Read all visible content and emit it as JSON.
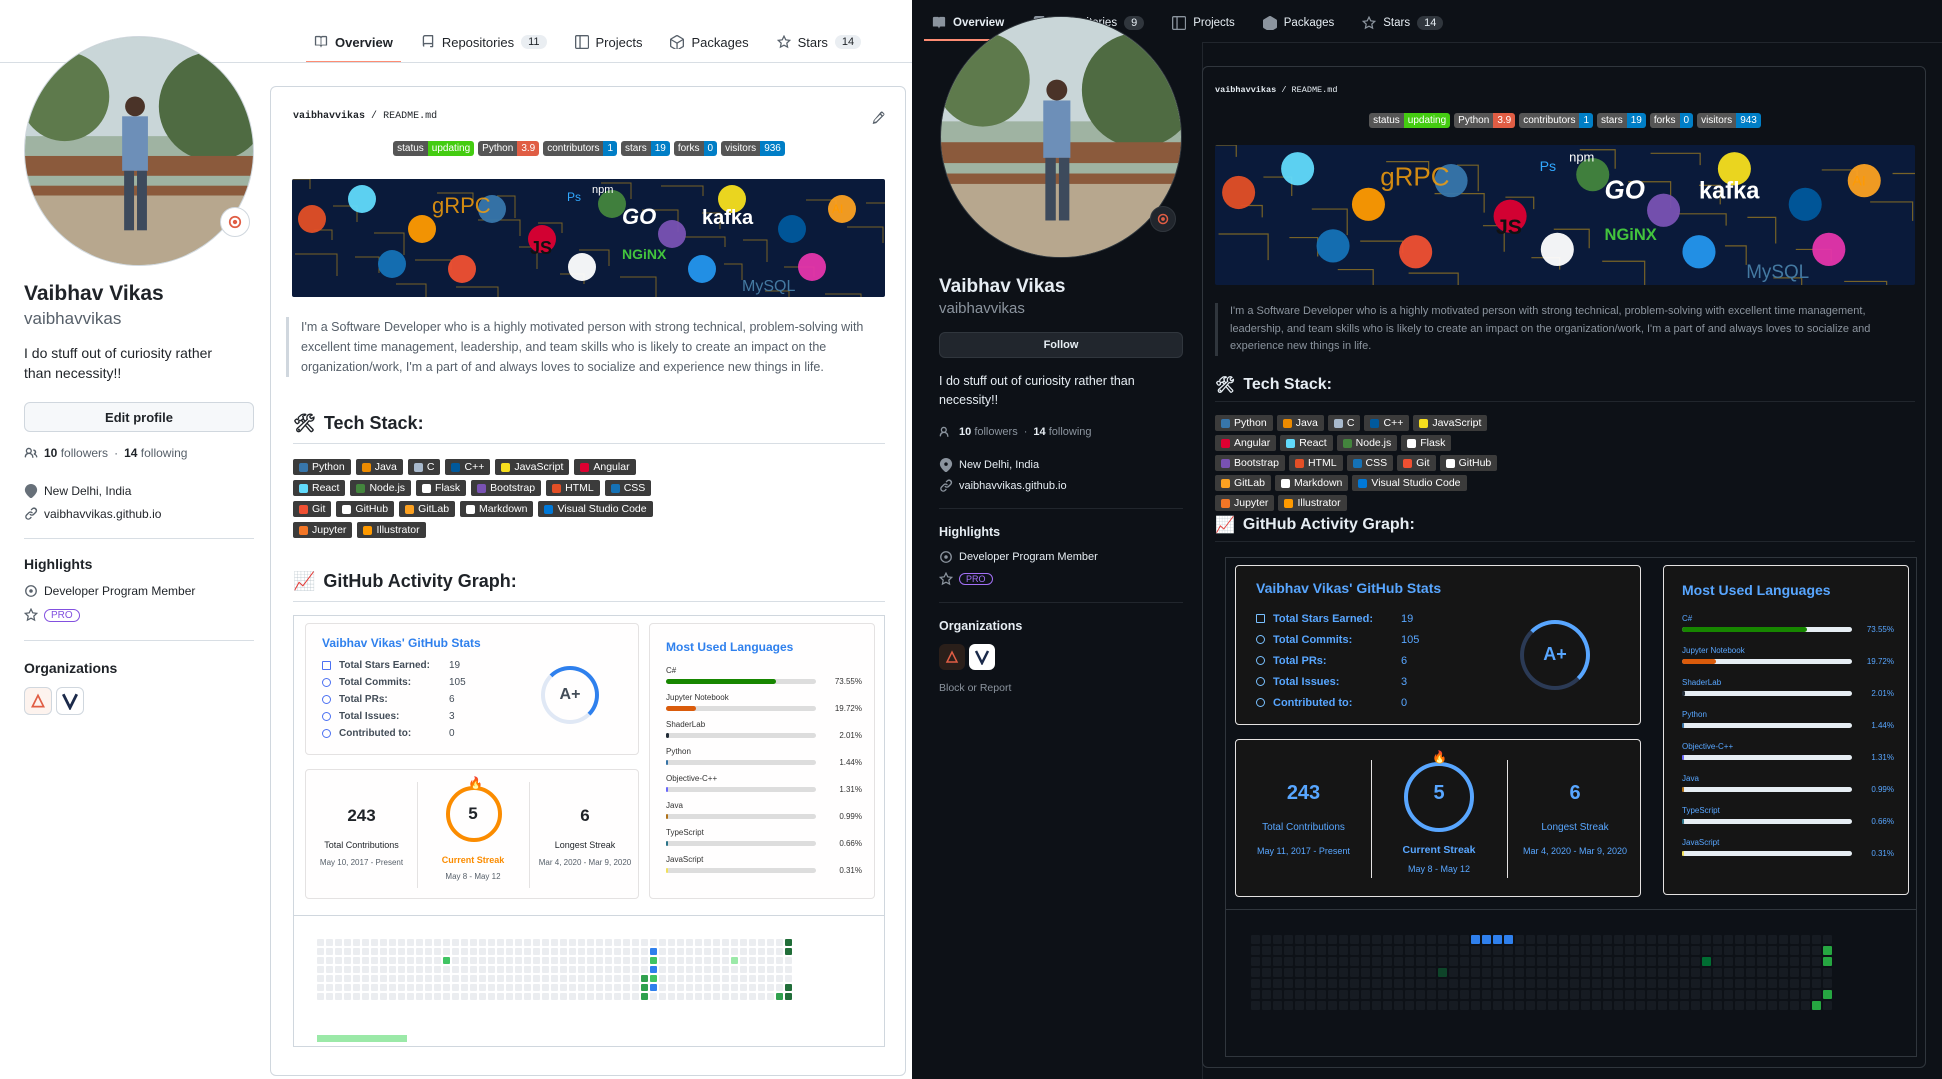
{
  "tabs": {
    "overview": "Overview",
    "repositories": "Repositories",
    "projects": "Projects",
    "packages": "Packages",
    "stars": "Stars"
  },
  "light": {
    "repos_count": "11",
    "stars_count": "14",
    "name": "Vaibhav Vikas",
    "login": "vaibhavvikas",
    "bio": "I do stuff out of curiosity rather than necessity!!",
    "edit_button": "Edit profile",
    "followers_num": "10",
    "followers_lbl": "followers",
    "following_num": "14",
    "following_lbl": "following",
    "sep": "·",
    "location": "New Delhi, India",
    "website": "vaibhavvikas.github.io",
    "highlights_title": "Highlights",
    "highlight_item": "Developer Program Member",
    "pro": "PRO",
    "orgs_title": "Organizations",
    "readme_path_user": "vaibhavvikas",
    "readme_path_sep": "/",
    "readme_path_file": "README.md",
    "badges": [
      {
        "k": "status",
        "v": "updating",
        "c": "#4c1"
      },
      {
        "k": "Python",
        "v": "3.9",
        "c": "#e05d44"
      },
      {
        "k": "contributors",
        "v": "1",
        "c": "#007ec6"
      },
      {
        "k": "stars",
        "v": "19",
        "c": "#007ec6"
      },
      {
        "k": "forks",
        "v": "0",
        "c": "#007ec6"
      },
      {
        "k": "visitors",
        "v": "936",
        "c": "#007ec6"
      }
    ],
    "about": "I'm a Software Developer who is a highly motivated person with strong technical, problem-solving with excellent time management, leadership, and team skills who is likely to create an impact on the organization/work, I'm a part of and always loves to socialize and experience new things in life.",
    "techstack_title": "Tech Stack:",
    "activity_title": "GitHub Activity Graph:",
    "stats": {
      "title": "Vaibhav Vikas' GitHub Stats",
      "rows": [
        {
          "label": "Total Stars Earned:",
          "value": "19"
        },
        {
          "label": "Total Commits:",
          "value": "105"
        },
        {
          "label": "Total PRs:",
          "value": "6"
        },
        {
          "label": "Total Issues:",
          "value": "3"
        },
        {
          "label": "Contributed to:",
          "value": "0"
        }
      ],
      "grade": "A+"
    },
    "streak": {
      "total": "243",
      "total_lbl": "Total Contributions",
      "total_range": "May 10, 2017 - Present",
      "current": "5",
      "current_lbl": "Current Streak",
      "current_range": "May 8 - May 12",
      "longest": "6",
      "longest_lbl": "Longest Streak",
      "longest_range": "Mar 4, 2020 - Mar 9, 2020"
    }
  },
  "dark": {
    "repos_count": "9",
    "stars_count": "14",
    "name": "Vaibhav Vikas",
    "login": "vaibhavvikas",
    "follow_button": "Follow",
    "bio": "I do stuff out of curiosity rather than necessity!!",
    "followers_num": "10",
    "followers_lbl": "followers",
    "following_num": "14",
    "following_lbl": "following",
    "sep": "·",
    "location": "New Delhi, India",
    "website": "vaibhavvikas.github.io",
    "highlights_title": "Highlights",
    "highlight_item": "Developer Program Member",
    "pro": "PRO",
    "orgs_title": "Organizations",
    "block": "Block or Report",
    "readme_path_user": "vaibhavvikas",
    "readme_path_sep": "/",
    "readme_path_file": "README.md",
    "badges": [
      {
        "k": "status",
        "v": "updating",
        "c": "#4c1"
      },
      {
        "k": "Python",
        "v": "3.9",
        "c": "#e05d44"
      },
      {
        "k": "contributors",
        "v": "1",
        "c": "#007ec6"
      },
      {
        "k": "stars",
        "v": "19",
        "c": "#007ec6"
      },
      {
        "k": "forks",
        "v": "0",
        "c": "#007ec6"
      },
      {
        "k": "visitors",
        "v": "943",
        "c": "#007ec6"
      }
    ],
    "about": "I'm a Software Developer who is a highly motivated person with strong technical, problem-solving with excellent time management, leadership, and team skills who is likely to create an impact on the organization/work, I'm a part of and always loves to socialize and experience new things in life.",
    "techstack_title": "Tech Stack:",
    "activity_title": "GitHub Activity Graph:",
    "stats": {
      "title": "Vaibhav Vikas' GitHub Stats",
      "rows": [
        {
          "label": "Total Stars Earned:",
          "value": "19"
        },
        {
          "label": "Total Commits:",
          "value": "105"
        },
        {
          "label": "Total PRs:",
          "value": "6"
        },
        {
          "label": "Total Issues:",
          "value": "3"
        },
        {
          "label": "Contributed to:",
          "value": "0"
        }
      ],
      "grade": "A+"
    },
    "streak": {
      "total": "243",
      "total_lbl": "Total Contributions",
      "total_range": "May 11, 2017 - Present",
      "current": "5",
      "current_lbl": "Current Streak",
      "current_range": "May 8 - May 12",
      "longest": "6",
      "longest_lbl": "Longest Streak",
      "longest_range": "Mar 4, 2020 - Mar 9, 2020"
    }
  },
  "langs_title": "Most Used Languages",
  "langs": [
    {
      "name": "C#",
      "pct": "73.55%",
      "value": 73.55,
      "color": "#178600"
    },
    {
      "name": "Jupyter Notebook",
      "pct": "19.72%",
      "value": 19.72,
      "color": "#DA5B0B"
    },
    {
      "name": "ShaderLab",
      "pct": "2.01%",
      "value": 2.01,
      "color": "#222c37"
    },
    {
      "name": "Python",
      "pct": "1.44%",
      "value": 1.44,
      "color": "#3572A5"
    },
    {
      "name": "Objective-C++",
      "pct": "1.31%",
      "value": 1.31,
      "color": "#6866fb"
    },
    {
      "name": "Java",
      "pct": "0.99%",
      "value": 0.99,
      "color": "#b07219"
    },
    {
      "name": "TypeScript",
      "pct": "0.66%",
      "value": 0.66,
      "color": "#2b7489"
    },
    {
      "name": "JavaScript",
      "pct": "0.31%",
      "value": 0.31,
      "color": "#f1e05a"
    }
  ],
  "tech": [
    {
      "name": "Python",
      "color": "#3776AB"
    },
    {
      "name": "Java",
      "color": "#ED8B00"
    },
    {
      "name": "C",
      "color": "#A8B9CC"
    },
    {
      "name": "C++",
      "color": "#00599C"
    },
    {
      "name": "JavaScript",
      "color": "#F7DF1E"
    },
    {
      "name": "Angular",
      "color": "#DD0031"
    },
    {
      "name": "React",
      "color": "#61DAFB"
    },
    {
      "name": "Node.js",
      "color": "#43853D"
    },
    {
      "name": "Flask",
      "color": "#ffffff"
    },
    {
      "name": "Bootstrap",
      "color": "#7952B3"
    },
    {
      "name": "HTML",
      "color": "#E34F26"
    },
    {
      "name": "CSS",
      "color": "#1572B6"
    },
    {
      "name": "Git",
      "color": "#F05032"
    },
    {
      "name": "GitHub",
      "color": "#ffffff"
    },
    {
      "name": "GitLab",
      "color": "#FCA121"
    },
    {
      "name": "Markdown",
      "color": "#ffffff"
    },
    {
      "name": "Visual Studio Code",
      "color": "#0078d7"
    },
    {
      "name": "Jupyter",
      "color": "#F37626"
    },
    {
      "name": "Illustrator",
      "color": "#FF9A00"
    }
  ],
  "banner_text": {
    "grpc": "gRPC",
    "go": "GO",
    "kafka": "kafka",
    "nginx": "NGiNX",
    "mysql": "MySQL",
    "js": "JS",
    "npm": "npm",
    "ps": "Ps",
    "ai": "AI"
  },
  "icons": {
    "book": "book-icon",
    "repo": "repo-icon",
    "project": "project-icon",
    "package": "package-icon",
    "star": "star-icon",
    "people": "people-icon",
    "location": "location-icon",
    "link": "link-icon",
    "badge": "badge-icon",
    "pencil": "pencil-icon"
  }
}
